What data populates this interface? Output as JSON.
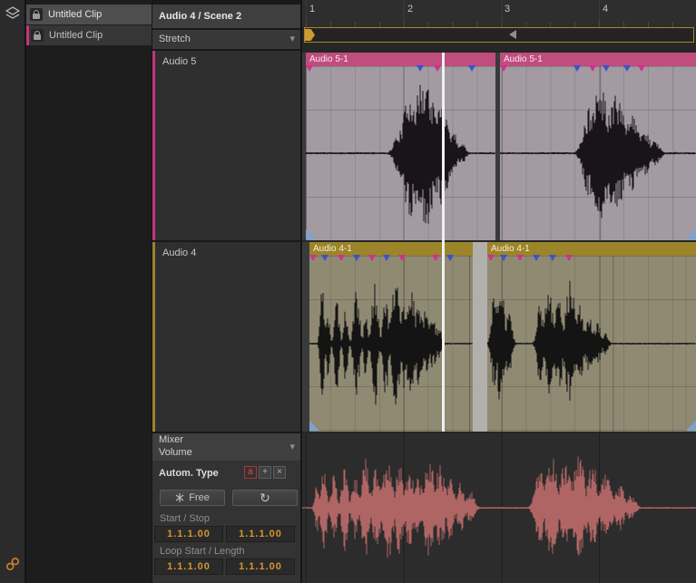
{
  "colors": {
    "pink": "#c9327e",
    "olive": "#9c842b",
    "orange_value": "#d7952f",
    "magenta_marker": "#d1308f",
    "blue_marker": "#3c52cc",
    "loop_border": "#a8882a"
  },
  "icons": {
    "dropdown_arrow": "▾",
    "loop_glyph": "↻"
  },
  "clip_list": {
    "items": [
      {
        "label": "Untitled Clip",
        "selected": true
      },
      {
        "label": "Untitled Clip",
        "selected": false
      }
    ]
  },
  "inspector": {
    "title": "Audio 4 / Scene 2",
    "stretch_label": "Stretch",
    "track_sections": [
      {
        "name": "Audio 5"
      },
      {
        "name": "Audio 4"
      }
    ],
    "automation_panel": {
      "selector_line1": "Mixer",
      "selector_line2": "Volume",
      "autom_type_label": "Autom. Type",
      "button_a": "a",
      "button_add": "+",
      "button_remove": "×",
      "free_button_label": "Free",
      "start_stop_label": "Start / Stop",
      "start_value": "1.1.1.00",
      "stop_value": "1.1.1.00",
      "loop_label": "Loop Start / Length",
      "loop_start_value": "1.1.1.00",
      "loop_length_value": "1.1.1.00"
    }
  },
  "timeline": {
    "ruler_marks": [
      "1",
      "2",
      "3",
      "4"
    ],
    "lanes": [
      {
        "track": "Audio 5",
        "clips": [
          {
            "label": "Audio 5-1"
          },
          {
            "label": "Audio 5-1"
          }
        ]
      },
      {
        "track": "Audio 4",
        "clips": [
          {
            "label": "Audio 4-1"
          },
          {
            "label": "Audio 4-1"
          }
        ]
      }
    ]
  }
}
